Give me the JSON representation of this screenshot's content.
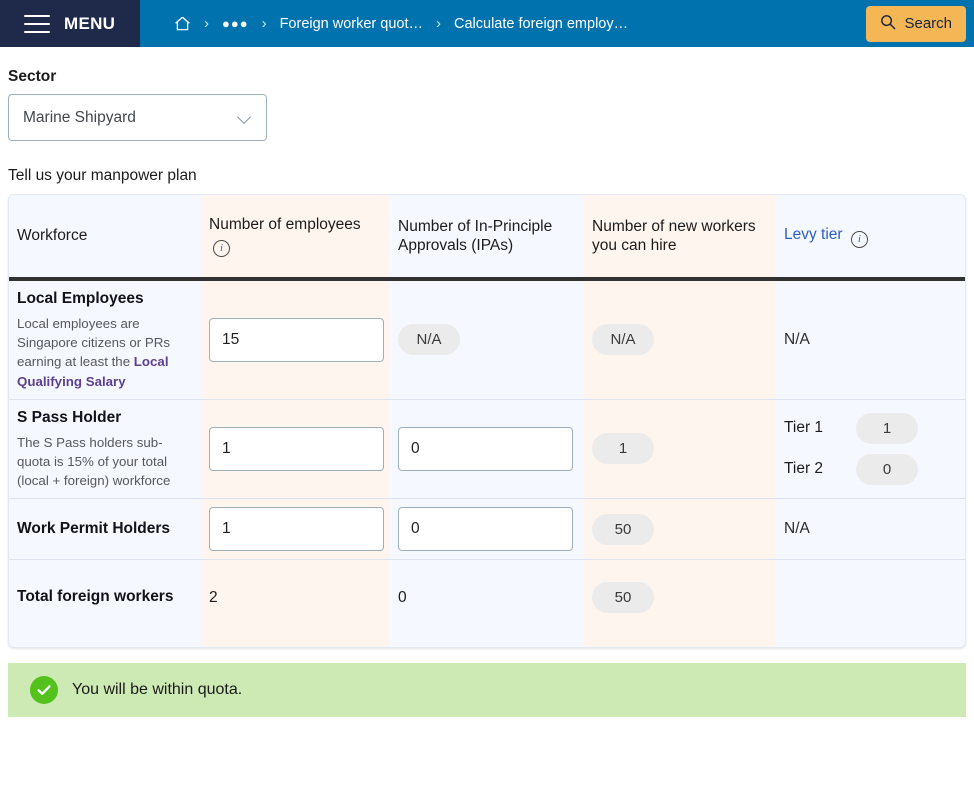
{
  "topbar": {
    "menu_label": "MENU",
    "menu_icon": "hamburger-icon",
    "breadcrumb": [
      {
        "label": "",
        "icon": "home-icon"
      },
      {
        "label": "●●●",
        "icon": "ellipsis-icon"
      },
      {
        "label": "Foreign worker quot…",
        "icon": ""
      },
      {
        "label": "Calculate foreign employ…",
        "icon": ""
      }
    ],
    "separator": "›",
    "search_label": "Search",
    "search_icon": "search-icon",
    "colors": {
      "menu_bg": "#1f2a4a",
      "bar_bg": "#0073ae",
      "search_bg": "#f5b655"
    }
  },
  "form": {
    "sector_label": "Sector",
    "sector_value": "Marine Shipyard",
    "chevron_icon": "chevron-down-icon",
    "section_title": "Tell us your manpower plan"
  },
  "table": {
    "headers": {
      "workforce": "Workforce",
      "employees": "Number of employees",
      "employees_icon": "info-icon",
      "ipa": "Number of In-Principle Approvals (IPAs)",
      "new_hires": "Number of new workers you can hire",
      "levy_tier": "Levy tier",
      "levy_tier_icon": "info-icon"
    },
    "rows": [
      {
        "title": "Local Employees",
        "desc_pre": "Local employees are Singapore citizens or PRs earning at least the ",
        "desc_link": "Local Qualifying Salary",
        "employees_value": "15",
        "ipa_pill": "N/A",
        "new_hires_pill": "N/A",
        "levy_plain": "N/A"
      },
      {
        "title": "S Pass Holder",
        "desc_pre": "The S Pass holders sub-quota is 15% of your total (local + foreign) workforce",
        "desc_link": "",
        "employees_value": "1",
        "ipa_value": "0",
        "new_hires_pill": "1",
        "tiers": [
          {
            "label": "Tier 1",
            "value": "1"
          },
          {
            "label": "Tier 2",
            "value": "0"
          }
        ]
      },
      {
        "title": "Work Permit Holders",
        "desc_pre": "",
        "desc_link": "",
        "employees_value": "1",
        "ipa_value": "0",
        "new_hires_pill": "50",
        "levy_plain": "N/A"
      }
    ],
    "total": {
      "title": "Total foreign workers",
      "employees": "2",
      "ipa": "0",
      "new_hires_pill": "50"
    }
  },
  "status": {
    "icon": "check-circle-icon",
    "message": "You will be within quota.",
    "bg_color": "#cdeab5",
    "icon_color": "#53c21c"
  }
}
